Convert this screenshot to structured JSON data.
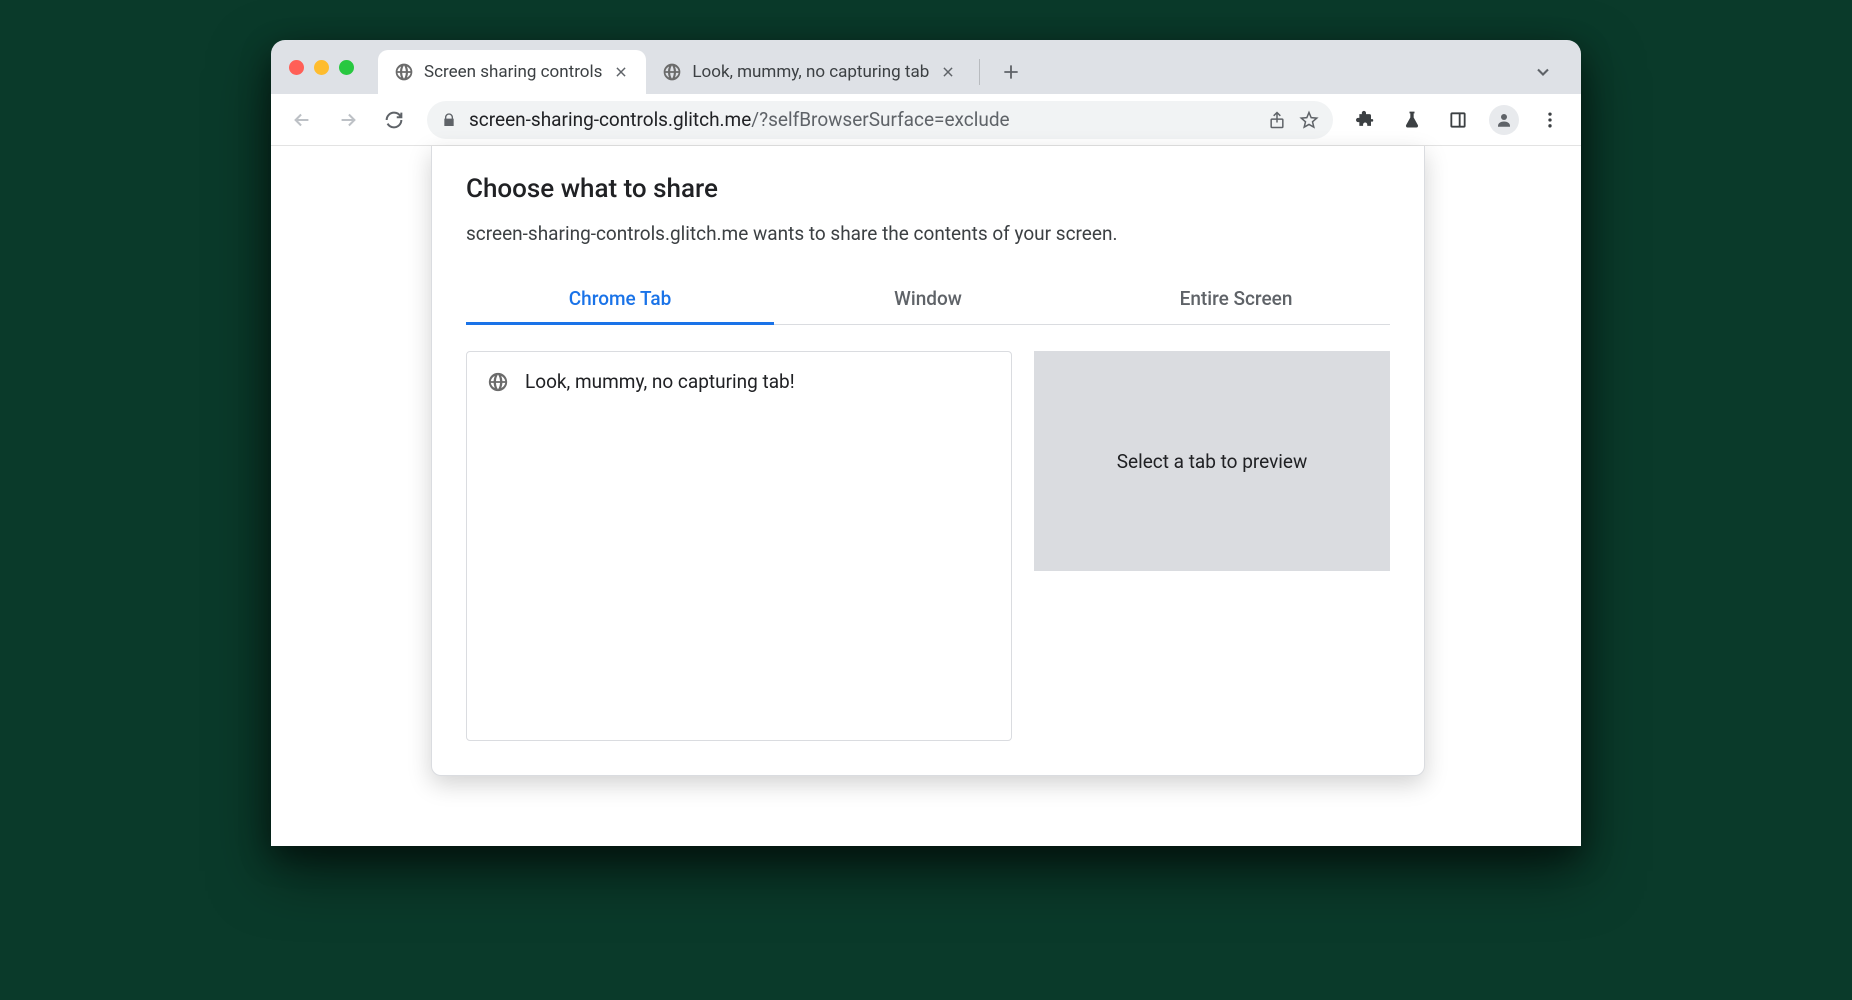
{
  "browser": {
    "tabs": [
      {
        "title": "Screen sharing controls",
        "active": true
      },
      {
        "title": "Look, mummy, no capturing tab",
        "active": false
      }
    ],
    "url_host": "screen-sharing-controls.glitch.me",
    "url_path": "/?selfBrowserSurface=exclude"
  },
  "dialog": {
    "title": "Choose what to share",
    "subtitle": "screen-sharing-controls.glitch.me wants to share the contents of your screen.",
    "tabs": [
      "Chrome Tab",
      "Window",
      "Entire Screen"
    ],
    "active_tab_index": 0,
    "tab_list": [
      {
        "title": "Look, mummy, no capturing tab!"
      }
    ],
    "preview_placeholder": "Select a tab to preview"
  }
}
